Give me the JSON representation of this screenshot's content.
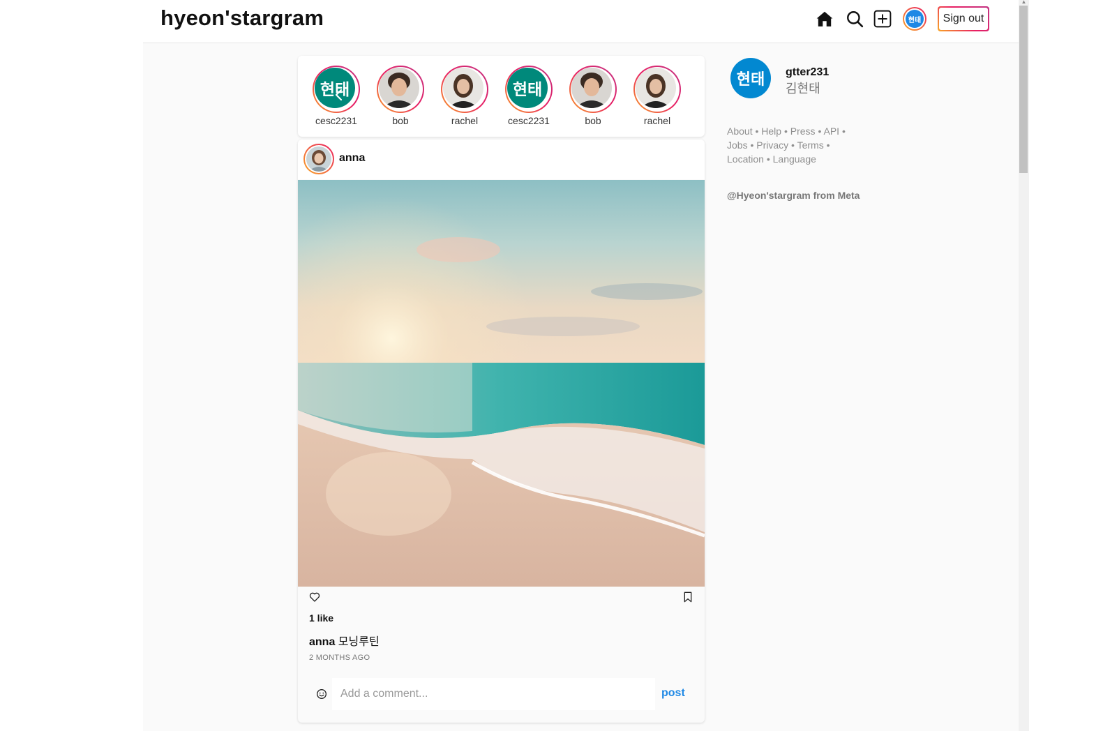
{
  "header": {
    "logo": "hyeon'stargram",
    "avatar_text": "현태",
    "signout_label": "Sign out",
    "icons": [
      "home-icon",
      "search-icon",
      "add-post-icon"
    ]
  },
  "stories": [
    {
      "username": "cesc2231",
      "avatar_type": "text",
      "avatar_text": "현태"
    },
    {
      "username": "bob",
      "avatar_type": "photo"
    },
    {
      "username": "rachel",
      "avatar_type": "photo"
    },
    {
      "username": "cesc2231",
      "avatar_type": "text",
      "avatar_text": "현태"
    },
    {
      "username": "bob",
      "avatar_type": "photo"
    },
    {
      "username": "rachel",
      "avatar_type": "photo"
    }
  ],
  "post": {
    "username": "anna",
    "likes": "1 like",
    "caption_user": "anna",
    "caption_text": "모닝루틴",
    "time": "2 MONTHS AGO",
    "comment_placeholder": "Add a comment...",
    "post_label": "post"
  },
  "sidebar": {
    "avatar_text": "현태",
    "username": "gtter231",
    "name": "김현태",
    "links": [
      "About",
      "Help",
      "Press",
      "API",
      "Jobs",
      "Privacy",
      "Terms",
      "Location",
      "Language"
    ],
    "copyright": "@Hyeon'stargram from Meta"
  },
  "colors": {
    "accent_blue": "#1e88e5",
    "story_ring_start": "#f9a825",
    "story_ring_end": "#c13584",
    "text_avatar_bg": "#00897b"
  }
}
